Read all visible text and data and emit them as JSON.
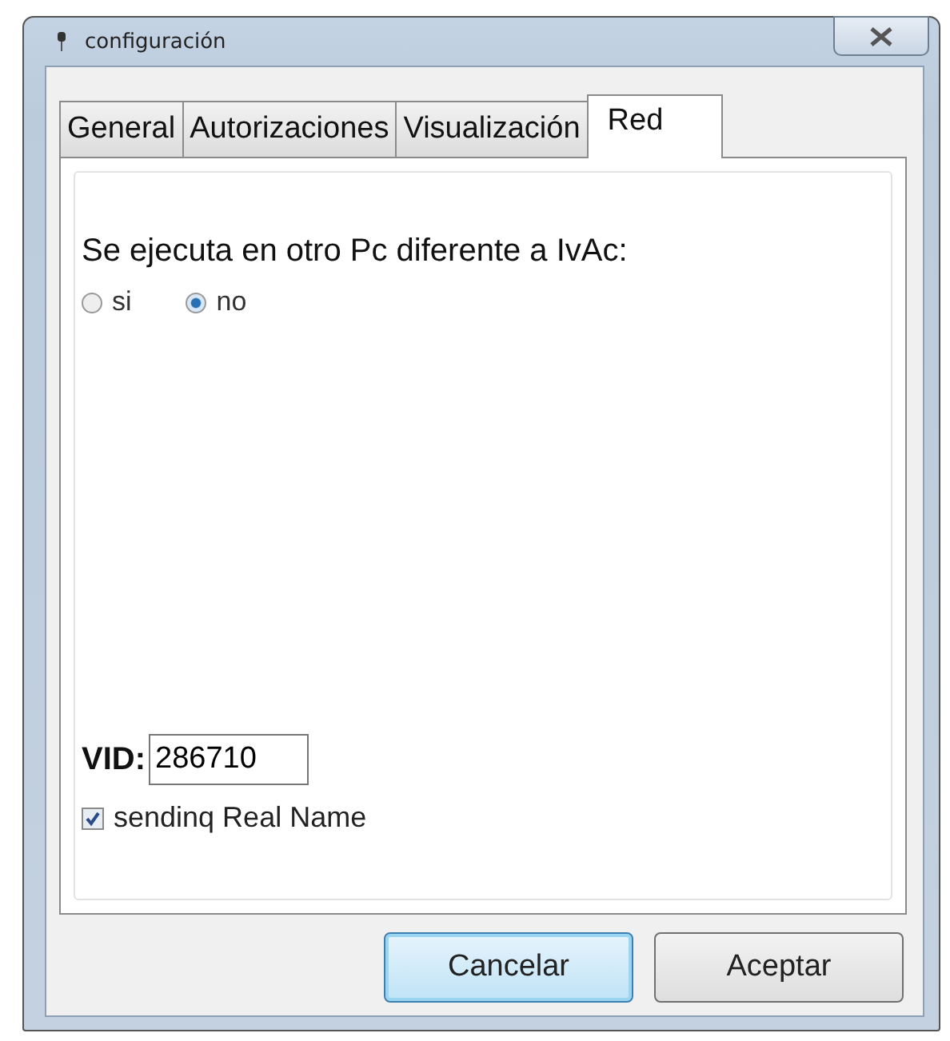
{
  "window": {
    "title": "configuración"
  },
  "tabs": [
    {
      "label": "General",
      "selected": false
    },
    {
      "label": "Autorizaciones",
      "selected": false
    },
    {
      "label": "Visualización",
      "selected": false
    },
    {
      "label": "Red",
      "selected": true
    }
  ],
  "question": "Se ejecuta en otro Pc diferente a IvAc:",
  "options": [
    {
      "label": "si",
      "selected": false
    },
    {
      "label": "no",
      "selected": true
    }
  ],
  "vid": {
    "label": "VID:",
    "value": "286710"
  },
  "sending_real_name": {
    "label": "sendinq Real Name",
    "checked": true
  },
  "buttons": [
    {
      "label": "Cancelar",
      "focused": true
    },
    {
      "label": "Aceptar",
      "focused": false
    }
  ]
}
